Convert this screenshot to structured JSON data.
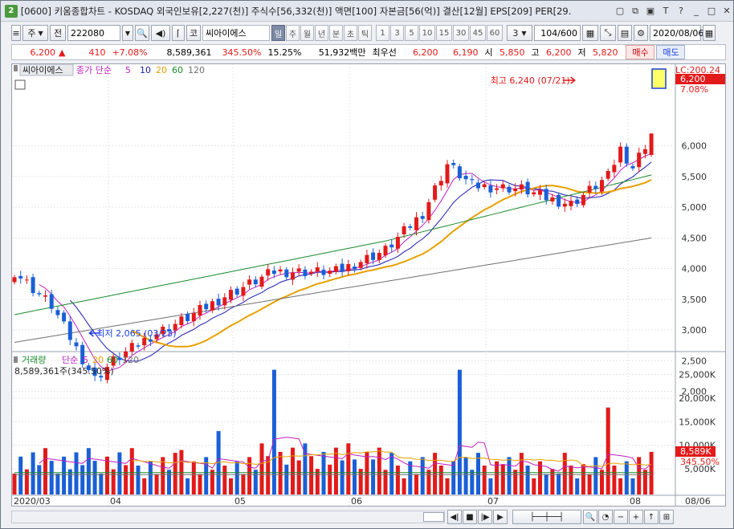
{
  "title": {
    "window_number": "2",
    "text": "[0600] 키움종합차트 - KOSDAQ 외국인보유[2,227(천)] 주식수[56,332(천)] 액면[100] 자본금[56(억)] 결산[12월] EPS[209] PER[29."
  },
  "toolbar": {
    "stock_type": "주",
    "prev_label": "전",
    "code": "222080",
    "name_btn": "코",
    "stock_name": "씨아이에스",
    "periods": [
      "일",
      "주",
      "월",
      "년",
      "분",
      "초",
      "틱"
    ],
    "selected_period": "일",
    "minute_opts": [
      "1",
      "3",
      "5",
      "10",
      "15",
      "30",
      "45",
      "60"
    ],
    "interval_value": "3",
    "page_count": "104/600",
    "date": "2020/08/06"
  },
  "quote": {
    "price": "6,200",
    "change": "410",
    "change_pct": "+7.08%",
    "volume": "8,589,361",
    "vol_ratio": "345.50%",
    "turnover": "15.25%",
    "amount": "51,932백만",
    "tag": "최우선",
    "ask": "6,200",
    "bid": "6,190",
    "open_label": "시",
    "open": "5,850",
    "high_label": "고",
    "high": "6,200",
    "low_label": "저",
    "low": "5,820",
    "buy_label": "매수",
    "sell_label": "매도"
  },
  "price_panel": {
    "stock_label": "씨아이에스",
    "ma_label": "종가 단순",
    "ma_periods": [
      "5",
      "10",
      "20",
      "60",
      "120"
    ],
    "lc_label": "LC:200.24",
    "last_price_tag": "6,200",
    "last_pct_tag": "7.08%",
    "high_marker": "최고 6,240 (07/21)",
    "low_marker": "최저 2,065 (03/23)",
    "y_ticks": [
      "6,000",
      "5,500",
      "5,000",
      "4,500",
      "4,000",
      "3,500",
      "3,000",
      "2,500",
      "2,000"
    ]
  },
  "volume_panel": {
    "label": "거래량",
    "ma_label": "단순",
    "ma_periods": [
      "5",
      "20",
      "60",
      "120"
    ],
    "last_value": "8,589,361주(345.50%)",
    "y_ticks": [
      "25,000K",
      "20,000K",
      "15,000K",
      "10,000K",
      "5,000K"
    ],
    "last_tag": "8,589K",
    "last_pct_tag": "345.50%"
  },
  "x_axis": {
    "labels": [
      "2020/03",
      "04",
      "05",
      "06",
      "07",
      "08",
      "08/06"
    ]
  },
  "colors": {
    "up": "#e21a1a",
    "down": "#1a5fd6",
    "ma5": "#c020c0",
    "ma10": "#1a1ab0",
    "ma20": "#e8a000",
    "ma60": "#1a8a2a",
    "ma120": "#707070"
  }
}
